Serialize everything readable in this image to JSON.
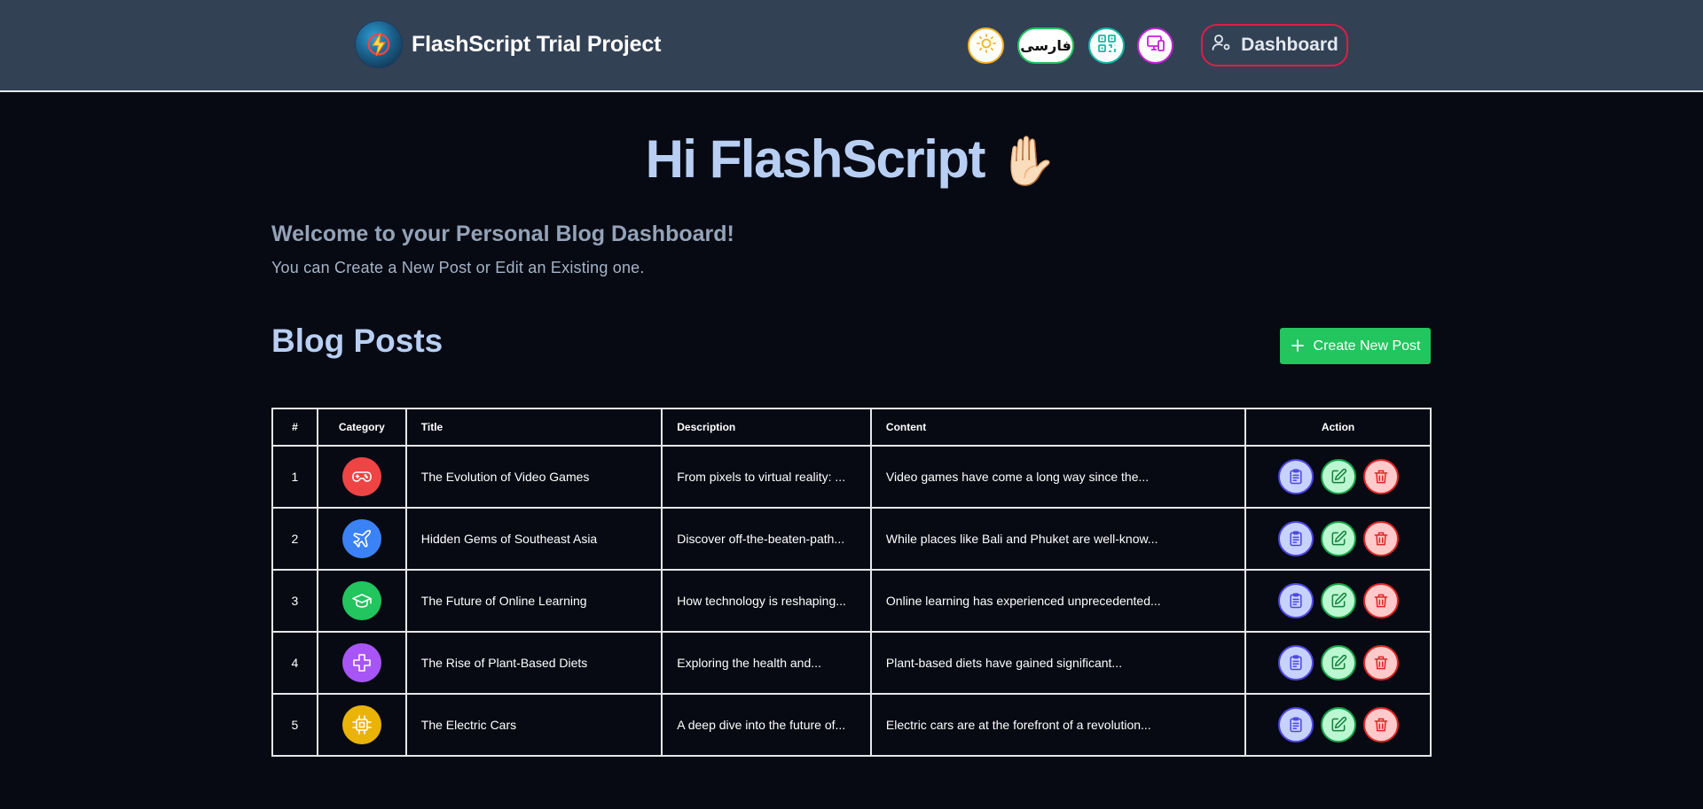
{
  "header": {
    "title": "FlashScript Trial Project",
    "language_label": "فارسی",
    "dashboard_label": "Dashboard",
    "icons": {
      "logo": "lightning-logo-icon",
      "theme": "sun-icon",
      "qr": "qr-code-icon",
      "device": "devices-icon",
      "user": "user-settings-icon"
    }
  },
  "greeting": {
    "text": "Hi FlashScript",
    "emoji": "✋🏻"
  },
  "welcome": {
    "title": "Welcome to your Personal Blog Dashboard!",
    "subtitle": "You can Create a New Post or Edit an Existing one."
  },
  "posts_section": {
    "title": "Blog Posts",
    "create_label": "Create New Post",
    "create_icon": "plus-icon"
  },
  "table": {
    "columns": [
      "#",
      "Category",
      "Title",
      "Description",
      "Content",
      "Action"
    ],
    "rows": [
      {
        "num": "1",
        "category_icon": "gamepad-icon",
        "category_color": "#ef4444",
        "title": "The Evolution of Video Games",
        "description": "From pixels to virtual reality: ...",
        "content": "Video games have come a long way since the..."
      },
      {
        "num": "2",
        "category_icon": "airplane-icon",
        "category_color": "#3b82f6",
        "title": "Hidden Gems of Southeast Asia",
        "description": "Discover off-the-beaten-path...",
        "content": "While places like Bali and Phuket are well-know..."
      },
      {
        "num": "3",
        "category_icon": "graduation-cap-icon",
        "category_color": "#22c55e",
        "title": "The Future of Online Learning",
        "description": "How technology is reshaping...",
        "content": "Online learning has experienced unprecedented..."
      },
      {
        "num": "4",
        "category_icon": "health-cross-icon",
        "category_color": "#a855f7",
        "title": "The Rise of Plant-Based Diets",
        "description": "Exploring the health and...",
        "content": "Plant-based diets have gained significant..."
      },
      {
        "num": "5",
        "category_icon": "chip-icon",
        "category_color": "#eab308",
        "title": "The Electric Cars",
        "description": "A deep dive into the future of...",
        "content": "Electric cars are at the forefront of a revolution..."
      }
    ],
    "action_icons": [
      "clipboard-view-icon",
      "edit-note-icon",
      "trash-icon"
    ]
  },
  "colors": {
    "page_bg": "#070a13",
    "header_bg": "#334155",
    "accent_green": "#22c55e",
    "heading_blue": "#b8cff3"
  }
}
